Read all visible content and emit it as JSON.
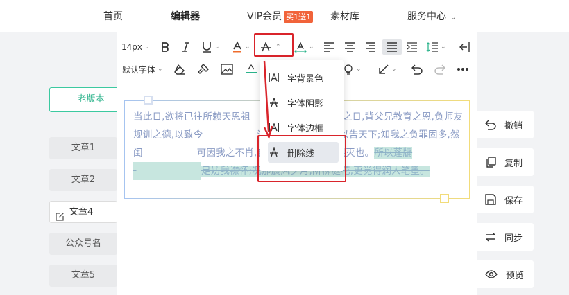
{
  "nav": {
    "home": "首页",
    "editor": "编辑器",
    "vip": "VIP会员",
    "vip_badge": "买1送1",
    "library": "素材库",
    "service": "服务中心"
  },
  "sidebar": {
    "old_version": "老版本",
    "items": [
      "文章1",
      "文章2",
      "文章4",
      "公众号名",
      "文章5"
    ]
  },
  "toolbar": {
    "font_size": "14px",
    "font_family": "默认字体"
  },
  "dropdown": {
    "items": [
      "字背景色",
      "字体阴影",
      "字体边框",
      "删除线"
    ]
  },
  "content": {
    "part1": "当此日,欲将已往所赖天恩祖",
    "part2": "厌甘餍肥之日,背父兄教育之恩,负师友规训之德,以致今",
    "part3": "潦倒之罪,编述一集,以告天下;知我之负罪固多,然闺",
    "part4": "可因我之不肖,自护己短,一并使其混灭也。",
    "strike1": "所以蓬牖",
    "strike2": "足妨我襟怀;况那晨风夕月,阶柳庭花,更觉得润人笔墨。"
  },
  "actions": [
    "撤销",
    "复制",
    "保存",
    "同步",
    "预览"
  ],
  "colors": {
    "accent_green": "#3cc9a0",
    "highlight_red": "#d9242b",
    "vip_orange": "#f1633a",
    "strike_bg": "#c7e6df"
  }
}
